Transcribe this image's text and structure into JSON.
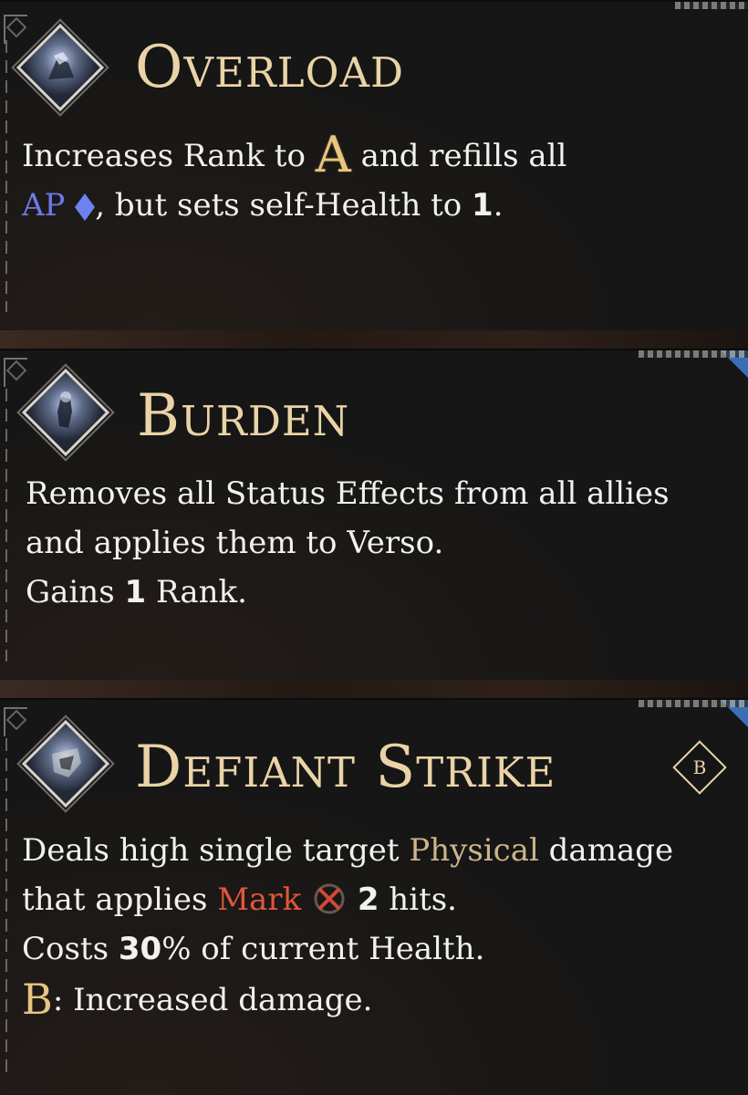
{
  "cards": [
    {
      "title": "Overload",
      "icon": "overload-skill-icon",
      "lines": {
        "l1_a": "Increases Rank to",
        "rank_letter": "A",
        "l1_b": "and refills all",
        "ap_label": "AP",
        "l2_b": ", but sets self-Health to",
        "health_value": "1",
        "l2_end": "."
      }
    },
    {
      "title": "Burden",
      "icon": "burden-skill-icon",
      "lines": {
        "l1": "Removes all Status Effects from all allies",
        "l2": "and applies them to Verso.",
        "l3_a": "Gains",
        "rank_gain": "1",
        "l3_b": "Rank."
      }
    },
    {
      "title": "Defiant Strike",
      "icon": "defiant-strike-skill-icon",
      "rank_badge": "B",
      "lines": {
        "l1_a": "Deals high single target",
        "physical": "Physical",
        "l1_b": "damage",
        "l2_a": "that applies",
        "mark": "Mark",
        "hits_value": "2",
        "l2_b": "hits.",
        "l3_a": "Costs",
        "cost_value": "30",
        "l3_b": "% of current Health.",
        "rank_letter": "B",
        "l4": ": Increased damage."
      }
    }
  ],
  "colors": {
    "title": "#ead3a6",
    "ap": "#6d79e6",
    "physical": "#cdb48a",
    "mark": "#e2563b",
    "rank_gold": "#e5c682"
  }
}
